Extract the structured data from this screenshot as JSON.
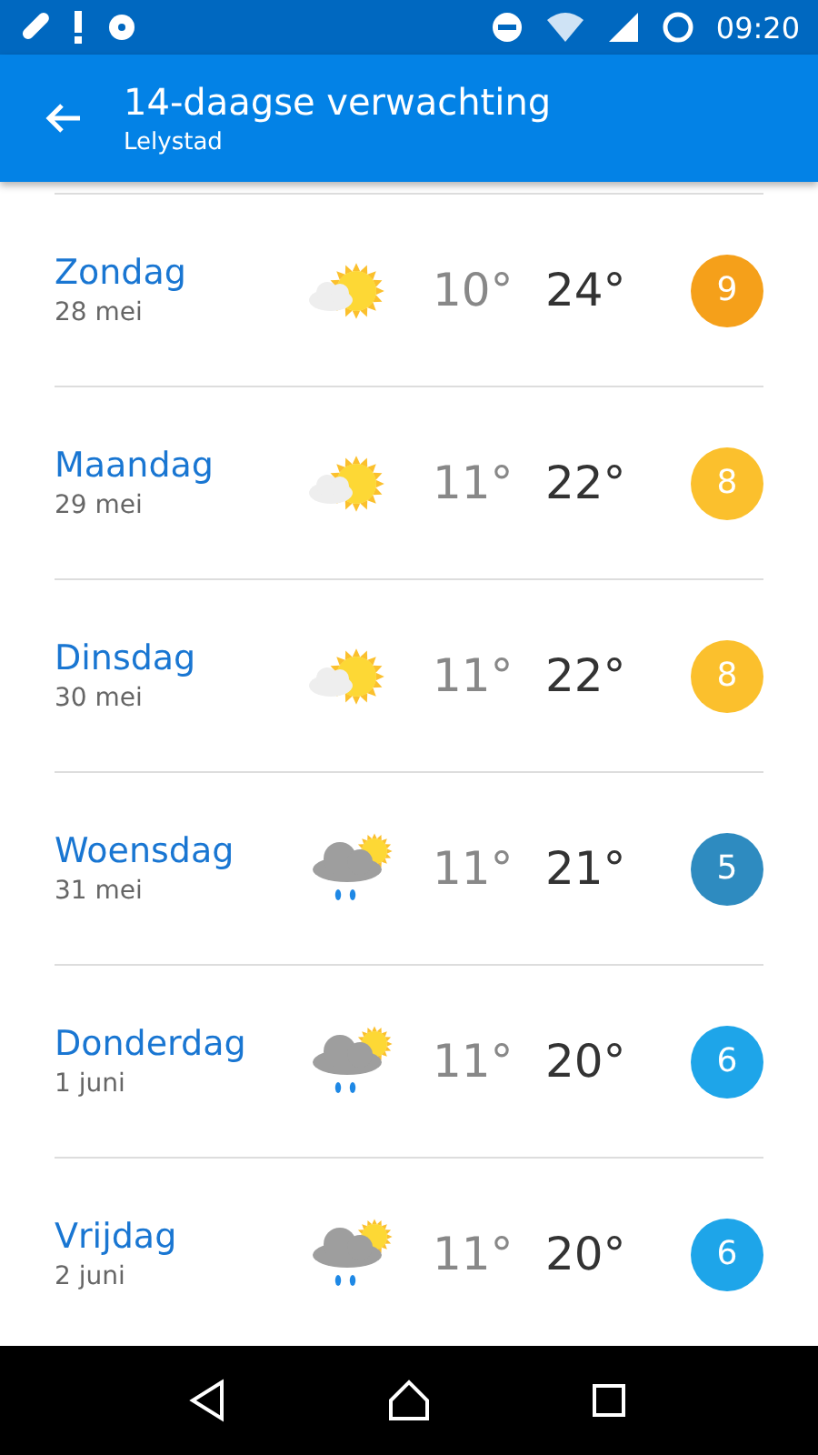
{
  "status_bar": {
    "time": "09:20"
  },
  "header": {
    "title": "14-daagse verwachting",
    "subtitle": "Lelystad"
  },
  "days": [
    {
      "day": "Zondag",
      "date": "28 mei",
      "kind": "sun-cloud",
      "min": "10°",
      "max": "24°",
      "score": "9",
      "color": "#f5a01a"
    },
    {
      "day": "Maandag",
      "date": "29 mei",
      "kind": "sun-cloud",
      "min": "11°",
      "max": "22°",
      "score": "8",
      "color": "#fbc02d"
    },
    {
      "day": "Dinsdag",
      "date": "30 mei",
      "kind": "sun-cloud",
      "min": "11°",
      "max": "22°",
      "score": "8",
      "color": "#fbc02d"
    },
    {
      "day": "Woensdag",
      "date": "31 mei",
      "kind": "rain",
      "min": "11°",
      "max": "21°",
      "score": "5",
      "color": "#2e8bc0"
    },
    {
      "day": "Donderdag",
      "date": "1 juni",
      "kind": "rain",
      "min": "11°",
      "max": "20°",
      "score": "6",
      "color": "#1ea5e9"
    },
    {
      "day": "Vrijdag",
      "date": "2 juni",
      "kind": "rain",
      "min": "11°",
      "max": "20°",
      "score": "6",
      "color": "#1ea5e9"
    }
  ]
}
